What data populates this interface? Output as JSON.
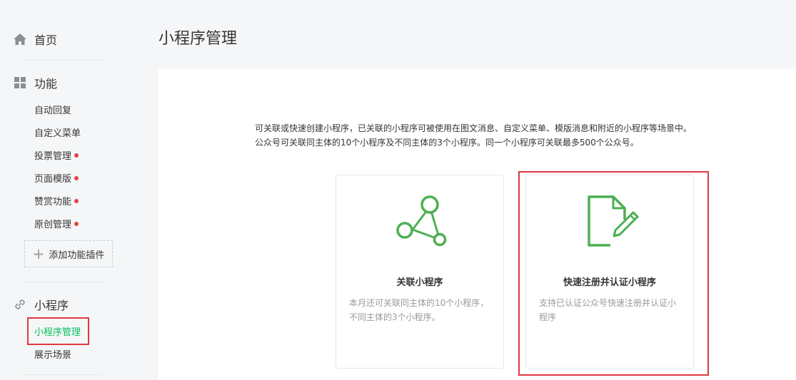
{
  "sidebar": {
    "home": {
      "label": "首页",
      "icon": "home-icon"
    },
    "features": {
      "label": "功能",
      "icon": "grid-icon",
      "items": [
        {
          "label": "自动回复",
          "dot": false
        },
        {
          "label": "自定义菜单",
          "dot": false
        },
        {
          "label": "投票管理",
          "dot": true
        },
        {
          "label": "页面模版",
          "dot": true
        },
        {
          "label": "赞赏功能",
          "dot": true
        },
        {
          "label": "原创管理",
          "dot": true
        }
      ],
      "add_plugin_label": "添加功能插件"
    },
    "miniprogram": {
      "label": "小程序",
      "icon": "link-icon",
      "items": [
        {
          "label": "小程序管理",
          "active": true
        },
        {
          "label": "展示场景",
          "active": false
        }
      ]
    }
  },
  "main": {
    "title": "小程序管理",
    "description": [
      "可关联或快速创建小程序，已关联的小程序可被使用在图文消息、自定义菜单、模版消息和附近的小程序等场景中。",
      "公众号可关联同主体的10个小程序及不同主体的3个小程序。同一个小程序可关联最多500个公众号。"
    ],
    "cards": [
      {
        "icon": "share-network-icon",
        "title": "关联小程序",
        "desc": "本月还可关联同主体的10个小程序，不同主体的3个小程序。"
      },
      {
        "icon": "document-edit-icon",
        "title": "快速注册并认证小程序",
        "desc": "支持已认证公众号快速注册并认证小程序"
      }
    ]
  },
  "colors": {
    "accent": "#07c160",
    "icon_green": "#4caf50",
    "dot_red": "#e64340",
    "highlight_red": "#e0393e"
  }
}
